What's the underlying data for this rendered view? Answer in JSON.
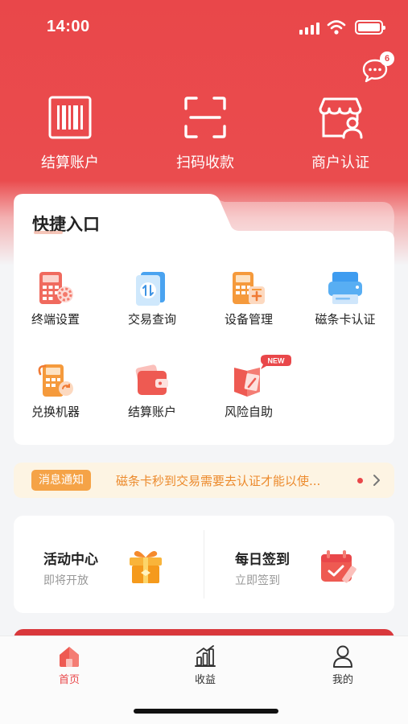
{
  "status_bar": {
    "time": "14:00"
  },
  "header": {
    "message_badge": "6"
  },
  "top_actions": [
    {
      "label": "结算账户",
      "icon": "barcode-icon"
    },
    {
      "label": "扫码收款",
      "icon": "scan-icon"
    },
    {
      "label": "商户认证",
      "icon": "store-verify-icon"
    }
  ],
  "quick_entry": {
    "title": "快捷入口",
    "items": [
      {
        "label": "终端设置",
        "icon": "terminal-settings-icon"
      },
      {
        "label": "交易查询",
        "icon": "transaction-query-icon"
      },
      {
        "label": "设备管理",
        "icon": "device-manage-icon"
      },
      {
        "label": "磁条卡认证",
        "icon": "card-reader-icon"
      },
      {
        "label": "兑换机器",
        "icon": "exchange-machine-icon"
      },
      {
        "label": "结算账户",
        "icon": "wallet-icon"
      },
      {
        "label": "风险自助",
        "icon": "risk-self-help-icon",
        "badge": "NEW"
      }
    ]
  },
  "notice": {
    "tag": "消息通知",
    "text": "磁条卡秒到交易需要去认证才能以使..."
  },
  "activities": [
    {
      "title": "活动中心",
      "subtitle": "即将开放",
      "icon": "gift-box-icon"
    },
    {
      "title": "每日签到",
      "subtitle": "立即签到",
      "icon": "calendar-check-icon"
    }
  ],
  "tabbar": [
    {
      "label": "首页",
      "icon": "home-icon",
      "active": true
    },
    {
      "label": "收益",
      "icon": "chart-bars-icon",
      "active": false
    },
    {
      "label": "我的",
      "icon": "user-icon",
      "active": false
    }
  ],
  "colors": {
    "primary": "#e9474a",
    "notice_bg": "#fdf4e3",
    "notice_tag": "#f5a347",
    "notice_text": "#ec8a2c"
  }
}
